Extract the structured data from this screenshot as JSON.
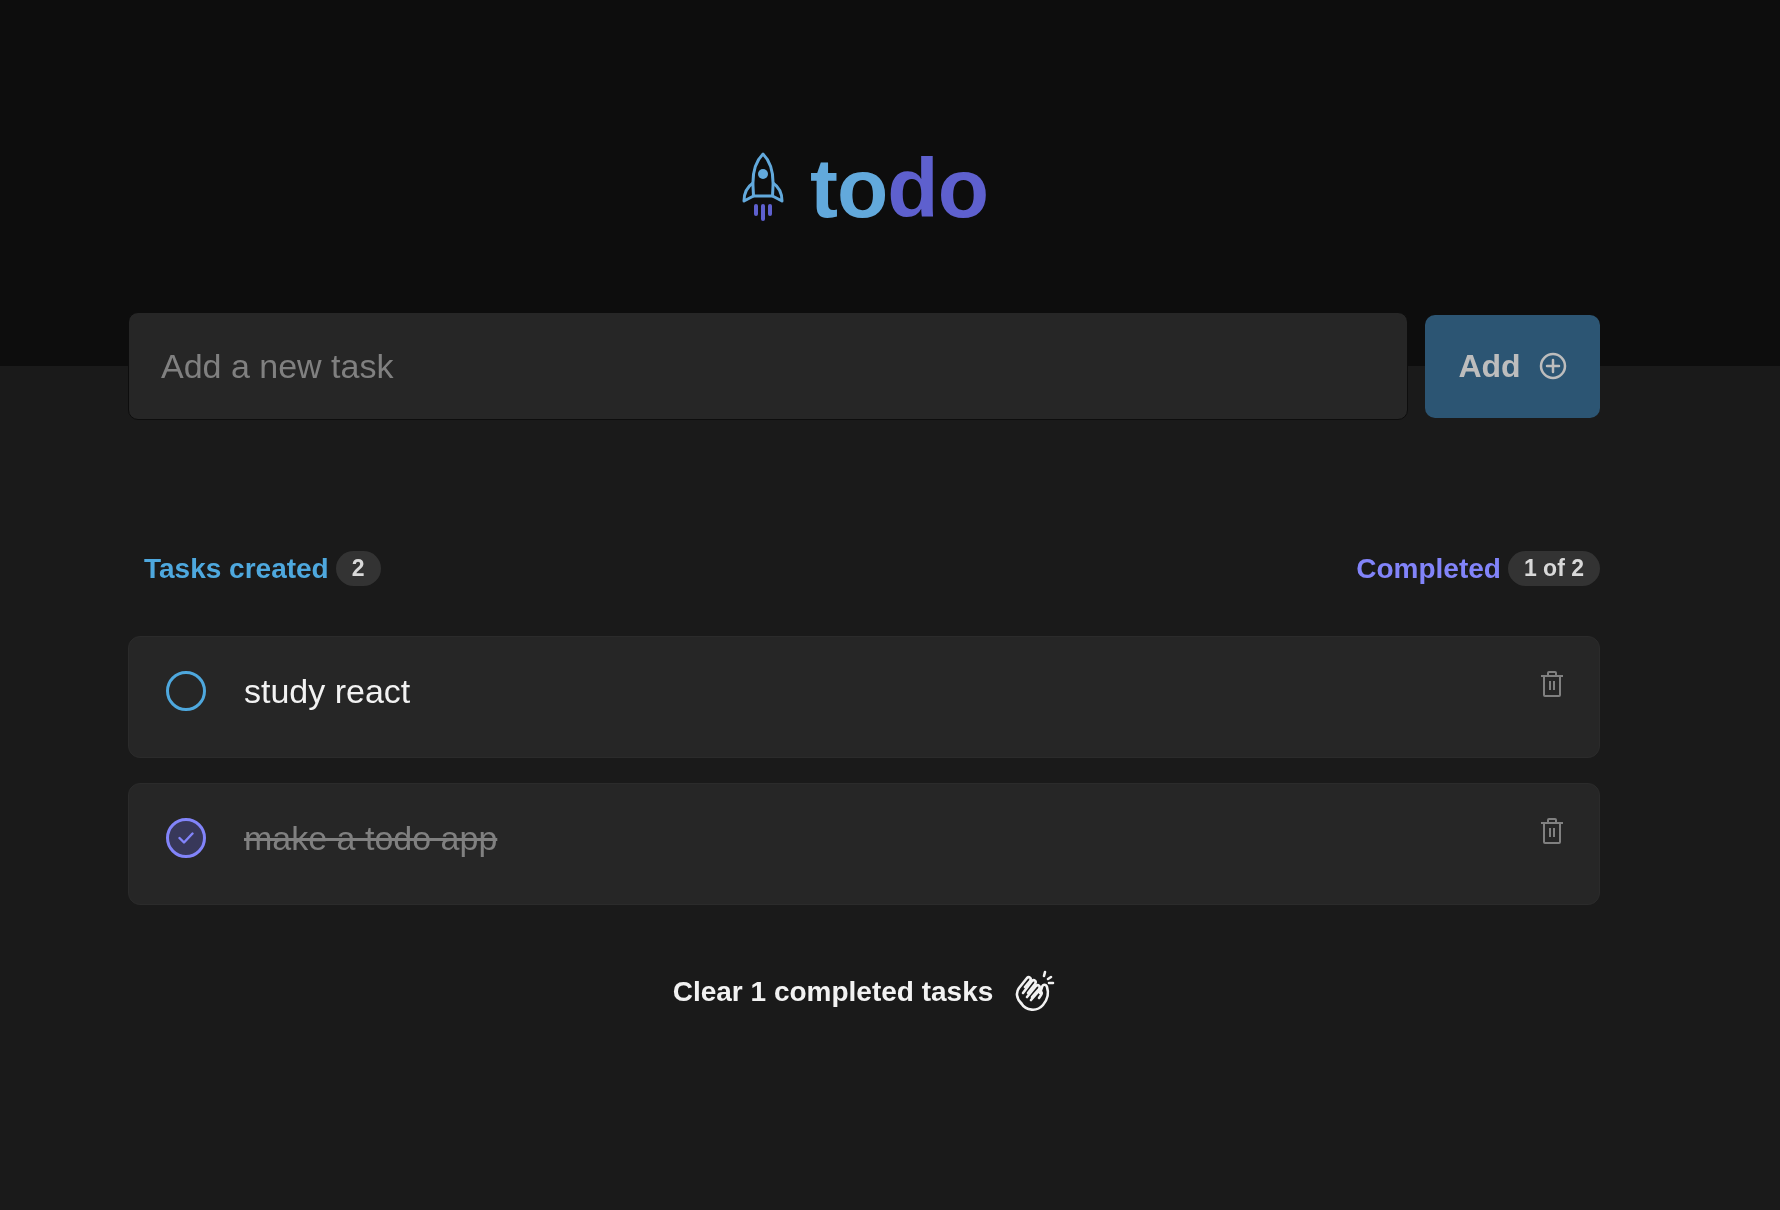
{
  "header": {
    "title_parts": [
      "to",
      "do"
    ]
  },
  "new_task": {
    "input": {
      "placeholder": "Add a new task"
    },
    "add_button": {
      "label": "Add"
    }
  },
  "stats": {
    "created": {
      "label": "Tasks created",
      "count": "2"
    },
    "completed": {
      "label": "Completed",
      "count": "1 of 2"
    }
  },
  "tasks": [
    {
      "text": "study react",
      "checked": false
    },
    {
      "text": "make a todo app",
      "checked": true
    }
  ],
  "clear_button": {
    "label": "Clear 1 completed tasks"
  }
}
